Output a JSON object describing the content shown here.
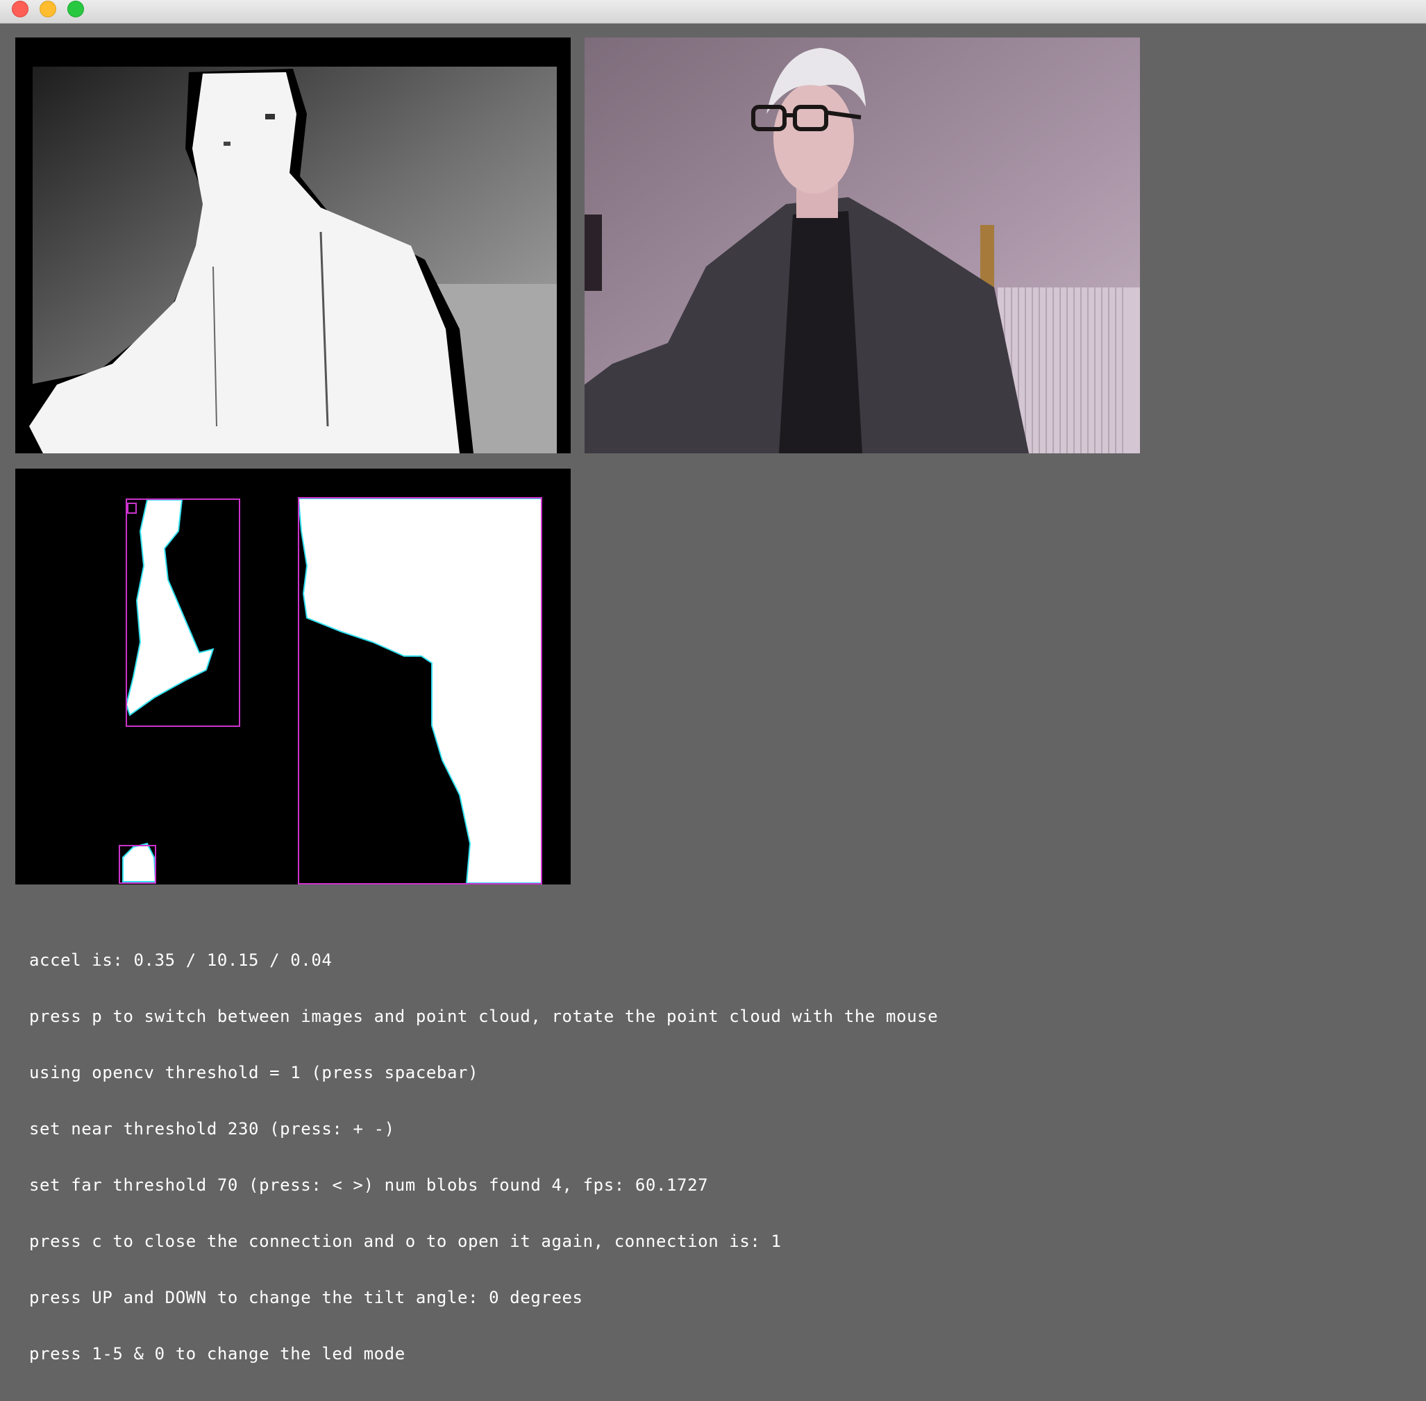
{
  "window": {
    "controls": [
      "close",
      "minimize",
      "maximize"
    ]
  },
  "views": {
    "depth": "depth-image",
    "color": "rgb-camera-image",
    "threshold": "thresholded-blob-image"
  },
  "blobs": {
    "count_shown": 4,
    "outline_color": "#cc33cc"
  },
  "status": {
    "lines": [
      "accel is: 0.35 / 10.15 / 0.04",
      "press p to switch between images and point cloud, rotate the point cloud with the mouse",
      "using opencv threshold = 1 (press spacebar)",
      "set near threshold 230 (press: + -)",
      "set far threshold 70 (press: < >) num blobs found 4, fps: 60.1727",
      "press c to close the connection and o to open it again, connection is: 1",
      "press UP and DOWN to change the tilt angle: 0 degrees",
      "press 1-5 & 0 to change the led mode"
    ]
  }
}
